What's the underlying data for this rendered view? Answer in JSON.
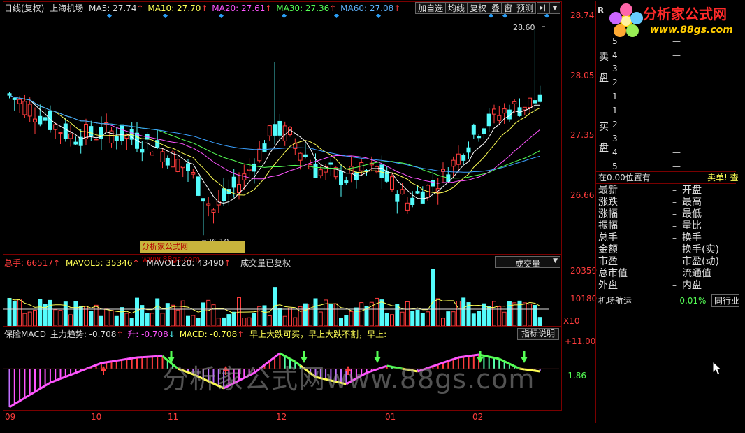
{
  "main_header": {
    "title": "日线(复权)",
    "stock": "上海机场",
    "ma5": "MA5: 27.74",
    "ma10": "MA10: 27.70",
    "ma20": "MA20: 27.61",
    "ma30": "MA30: 27.36",
    "ma60": "MA60: 27.08",
    "up_arrow": "↑"
  },
  "toolbar": {
    "buttons": [
      "加自选",
      "均线",
      "复权",
      "叠",
      "窗",
      "预测"
    ],
    "menu": "▸|",
    "dropdown": "▼"
  },
  "price_axis": [
    "28.74",
    "28.05",
    "27.35",
    "26.66"
  ],
  "annotations": {
    "high": "28.60",
    "low": "26.10",
    "watermark_small": "分析家公式网 www.88gs.com"
  },
  "volume_header": {
    "total": "总手: 66517",
    "mavol5": "MAVOL5: 35346",
    "mavol120": "MAVOL120: 43490",
    "note": "成交量已复权",
    "selector": "成交量"
  },
  "volume_axis": [
    "20359",
    "10180",
    "X10"
  ],
  "macd_header": {
    "name": "保险MACD",
    "trend": "主力趋势: -0.708",
    "rise": "升: -0.708",
    "macd": "MACD: -0.708",
    "text": "早上大跌可买，早上大跌不割，早上:",
    "explain": "指标说明"
  },
  "macd_axis": [
    "+11.00",
    "-1.86"
  ],
  "date_axis": [
    "09",
    "10",
    "11",
    "12",
    "01",
    "02"
  ],
  "watermark": "分析家公式网www.88gs.com",
  "logo": {
    "title": "分析家公式网",
    "url": "www.88gs.com"
  },
  "side": {
    "r_mark": "R",
    "sell_label": [
      "卖",
      "盘"
    ],
    "buy_label": [
      "买",
      "盘"
    ],
    "sell_rows": [
      "5",
      "4",
      "3",
      "2",
      "1"
    ],
    "buy_rows": [
      "1",
      "2",
      "3",
      "4",
      "5"
    ],
    "dash": "—",
    "status_left": "在0.00位置有",
    "status_right": "卖单! 查",
    "stats_left": [
      "最新",
      "涨跌",
      "涨幅",
      "振幅",
      "总手",
      "金额",
      "市盈",
      "总市值",
      "外盘"
    ],
    "stats_right": [
      "开盘",
      "最高",
      "最低",
      "量比",
      "换手",
      "换手(实)",
      "市盈(动)",
      "流通值",
      "内盘"
    ],
    "sector_name": "机场航运",
    "sector_change": "-0.01%",
    "sector_tab": "同行业"
  },
  "colors": {
    "red": "#ff3c3c",
    "cyan": "#54fcfc",
    "yellow": "#ffff55",
    "magenta": "#ff55ff",
    "green": "#55ff55",
    "blue": "#3aa0ff"
  },
  "chart_data": {
    "type": "candlestick",
    "x_labels": [
      "09",
      "10",
      "11",
      "12",
      "01",
      "02"
    ],
    "ylim": [
      26.0,
      28.74
    ],
    "price_ticks": [
      28.74,
      28.05,
      27.35,
      26.66
    ],
    "annotated_high": 28.6,
    "annotated_low": 26.1,
    "ma_values_last": {
      "MA5": 27.74,
      "MA10": 27.7,
      "MA20": 27.61,
      "MA30": 27.36,
      "MA60": 27.08
    },
    "volume_ticks": [
      20359,
      10180
    ],
    "volume_total": 66517,
    "mavol5": 35346,
    "mavol120": 43490,
    "macd_ticks": [
      11.0,
      -1.86
    ],
    "macd_value": -0.708
  }
}
